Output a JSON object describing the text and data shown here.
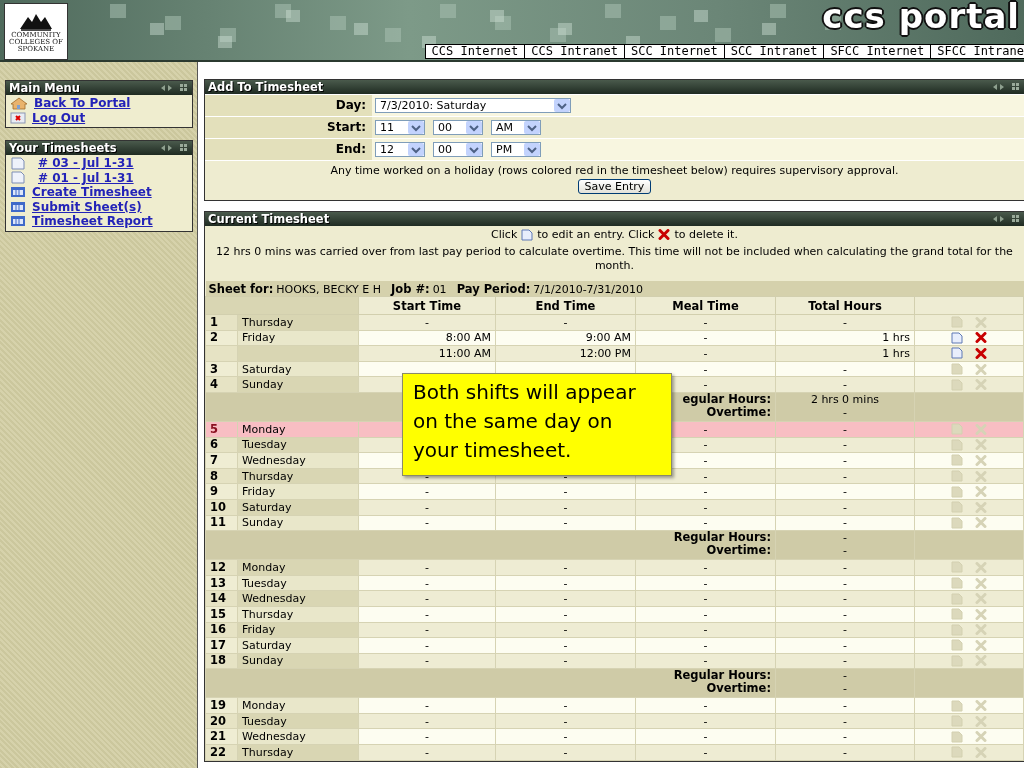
{
  "header": {
    "logo_text": "COMMUNITY COLLEGES OF SPOKANE",
    "title": "ccs portal",
    "links": [
      "CCS Internet",
      "CCS Intranet",
      "SCC Internet",
      "SCC Intranet",
      "SFCC Internet",
      "SFCC Intrane"
    ]
  },
  "sidebar": [
    {
      "title": "Main Menu",
      "items": [
        {
          "label": "Back To Portal",
          "kind": "home"
        },
        {
          "label": "Log Out",
          "kind": "logout"
        }
      ]
    },
    {
      "title": "Your Timesheets",
      "items": [
        {
          "label": "# 03 - Jul 1-31",
          "kind": "sheet"
        },
        {
          "label": "# 01 - Jul 1-31",
          "kind": "sheet"
        },
        {
          "label": "Create Timesheet",
          "kind": "action"
        },
        {
          "label": "Submit Sheet(s)",
          "kind": "action"
        },
        {
          "label": "Timesheet Report",
          "kind": "action"
        }
      ]
    }
  ],
  "add_panel": {
    "title": "Add To Timesheet",
    "fields": [
      {
        "label": "Day:",
        "selects": [
          "7/3/2010: Saturday"
        ]
      },
      {
        "label": "Start:",
        "selects": [
          "11",
          "00",
          "AM"
        ]
      },
      {
        "label": "End:",
        "selects": [
          "12",
          "00",
          "PM"
        ]
      }
    ],
    "note": "Any time worked on a holiday (rows colored red in the timesheet below) requires supervisory approval.",
    "button": "Save Entry"
  },
  "timesheet": {
    "title": "Current Timesheet",
    "hint_parts": [
      "Click",
      "to edit an entry. Click",
      "to delete it."
    ],
    "carryover": "12 hrs 0 mins was carried over from last pay period to calculate overtime. This time will not be included when calculating the grand total for the month.",
    "sheet_info": [
      {
        "label": "Sheet for:",
        "value": "HOOKS, BECKY E H"
      },
      {
        "label": "Job #:",
        "value": "01"
      },
      {
        "label": "Pay Period:",
        "value": "7/1/2010-7/31/2010"
      }
    ],
    "columns": [
      "Start Time",
      "End Time",
      "Meal Time",
      "Total Hours"
    ],
    "rows": [
      {
        "kind": "day",
        "num": "1",
        "day": "Thursday",
        "start": "-",
        "end": "-",
        "meal": "-",
        "total": "-",
        "holiday": false,
        "editable": false
      },
      {
        "kind": "day",
        "num": "2",
        "day": "Friday",
        "start": "8:00 AM",
        "end": "9:00 AM",
        "meal": "-",
        "total": "1 hrs",
        "holiday": false,
        "editable": true
      },
      {
        "kind": "entry",
        "start": "11:00 AM",
        "end": "12:00 PM",
        "meal": "-",
        "total": "1 hrs",
        "holiday": false,
        "editable": true
      },
      {
        "kind": "day",
        "num": "3",
        "day": "Saturday",
        "meal": "-",
        "total": "-",
        "holiday": false,
        "editable": false
      },
      {
        "kind": "day",
        "num": "4",
        "day": "Sunday",
        "meal": "-",
        "total": "-",
        "holiday": false,
        "editable": false
      },
      {
        "kind": "subtotal",
        "labels": [
          "egular Hours:",
          "Overtime:"
        ],
        "values": [
          "2 hrs 0 mins",
          "-"
        ]
      },
      {
        "kind": "day",
        "num": "5",
        "day": "Monday",
        "meal": "-",
        "total": "-",
        "holiday": true,
        "editable": false
      },
      {
        "kind": "day",
        "num": "6",
        "day": "Tuesday",
        "meal": "-",
        "total": "-",
        "holiday": false,
        "editable": false
      },
      {
        "kind": "day",
        "num": "7",
        "day": "Wednesday",
        "meal": "-",
        "total": "-",
        "holiday": false,
        "editable": false
      },
      {
        "kind": "day",
        "num": "8",
        "day": "Thursday",
        "start": "-",
        "end": "-",
        "meal": "-",
        "total": "-",
        "holiday": false,
        "editable": false
      },
      {
        "kind": "day",
        "num": "9",
        "day": "Friday",
        "start": "-",
        "end": "-",
        "meal": "-",
        "total": "-",
        "holiday": false,
        "editable": false
      },
      {
        "kind": "day",
        "num": "10",
        "day": "Saturday",
        "start": "-",
        "end": "-",
        "meal": "-",
        "total": "-",
        "holiday": false,
        "editable": false
      },
      {
        "kind": "day",
        "num": "11",
        "day": "Sunday",
        "start": "-",
        "end": "-",
        "meal": "-",
        "total": "-",
        "holiday": false,
        "editable": false
      },
      {
        "kind": "subtotal",
        "labels": [
          "Regular Hours:",
          "Overtime:"
        ],
        "values": [
          "-",
          "-"
        ]
      },
      {
        "kind": "day",
        "num": "12",
        "day": "Monday",
        "start": "-",
        "end": "-",
        "meal": "-",
        "total": "-",
        "holiday": false,
        "editable": false
      },
      {
        "kind": "day",
        "num": "13",
        "day": "Tuesday",
        "start": "-",
        "end": "-",
        "meal": "-",
        "total": "-",
        "holiday": false,
        "editable": false
      },
      {
        "kind": "day",
        "num": "14",
        "day": "Wednesday",
        "start": "-",
        "end": "-",
        "meal": "-",
        "total": "-",
        "holiday": false,
        "editable": false
      },
      {
        "kind": "day",
        "num": "15",
        "day": "Thursday",
        "start": "-",
        "end": "-",
        "meal": "-",
        "total": "-",
        "holiday": false,
        "editable": false
      },
      {
        "kind": "day",
        "num": "16",
        "day": "Friday",
        "start": "-",
        "end": "-",
        "meal": "-",
        "total": "-",
        "holiday": false,
        "editable": false
      },
      {
        "kind": "day",
        "num": "17",
        "day": "Saturday",
        "start": "-",
        "end": "-",
        "meal": "-",
        "total": "-",
        "holiday": false,
        "editable": false
      },
      {
        "kind": "day",
        "num": "18",
        "day": "Sunday",
        "start": "-",
        "end": "-",
        "meal": "-",
        "total": "-",
        "holiday": false,
        "editable": false
      },
      {
        "kind": "subtotal",
        "labels": [
          "Regular Hours:",
          "Overtime:"
        ],
        "values": [
          "-",
          "-"
        ]
      },
      {
        "kind": "day",
        "num": "19",
        "day": "Monday",
        "start": "-",
        "end": "-",
        "meal": "-",
        "total": "-",
        "holiday": false,
        "editable": false
      },
      {
        "kind": "day",
        "num": "20",
        "day": "Tuesday",
        "start": "-",
        "end": "-",
        "meal": "-",
        "total": "-",
        "holiday": false,
        "editable": false
      },
      {
        "kind": "day",
        "num": "21",
        "day": "Wednesday",
        "start": "-",
        "end": "-",
        "meal": "-",
        "total": "-",
        "holiday": false,
        "editable": false
      },
      {
        "kind": "day",
        "num": "22",
        "day": "Thursday",
        "start": "-",
        "end": "-",
        "meal": "-",
        "total": "-",
        "holiday": false,
        "editable": false
      }
    ]
  },
  "callout": {
    "text": "Both shifts will appear on the same day on your timesheet."
  }
}
